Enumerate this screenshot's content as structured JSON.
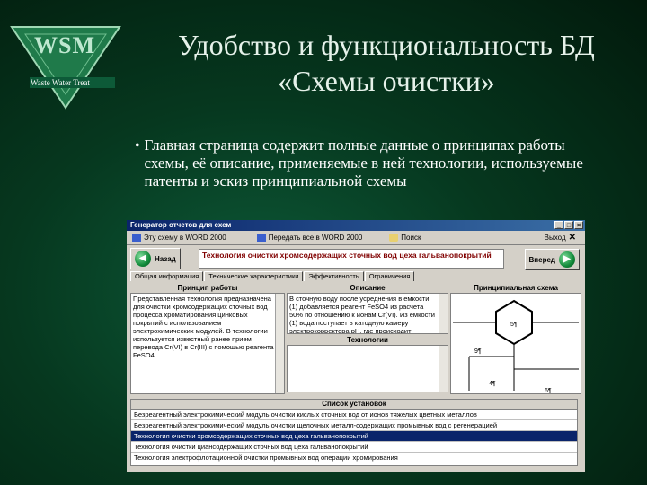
{
  "logo": {
    "text": "WSM",
    "subtitle": "Waste Water Treat"
  },
  "slide": {
    "title": "Удобство и функциональность БД «Схемы очистки»",
    "bullet": "Главная страница содержит полные данные о принципах работы схемы, её описание, применяемые в ней технологии, используемые патенты и эскиз принципиальной схемы"
  },
  "window": {
    "title": "Генератор отчетов для схем",
    "menu": {
      "word": "Эту схему в WORD 2000",
      "print_all": "Передать все в WORD 2000",
      "search": "Поиск",
      "exit": "Выход"
    },
    "nav": {
      "back": "Назад",
      "forward": "Вперед",
      "tech_name": "Технология очистки хромсодержащих сточных вод цеха гальванопокрытий"
    },
    "tabs": [
      "Общая информация",
      "Технические характеристики",
      "Эффективность",
      "Ограничения"
    ],
    "panels": {
      "principle_title": "Принцип работы",
      "principle_text": "Представленная технология предназначена для очистки хромсодержащих сточных вод процесса хроматирования цинковых покрытий с использованием электрохимических модулей. В технологии используется известный ранее прием перевода Cr(VI) в Cr(III) с помощью реагента FeSO4.",
      "desc_title": "Описание",
      "desc_text": "В сточную воду после усреднения в емкости (1) добавляется реагент FeSO4 из расчета 50% по отношению к ионам Cr(VI). Из емкости (1) вода поступает в катодную камеру электрокорректора pH, где происходит подщелачивание воды.",
      "tech_title": "Технологии",
      "scheme_title": "Принципиальная схема",
      "scheme_labels": [
        "5¶",
        "9¶",
        "4¶",
        "6¶"
      ]
    },
    "list": {
      "title": "Список установок",
      "items": [
        "Безреагентный электрохимический модуль очистки кислых сточных вод от ионов тяжелых цветных металлов",
        "Безреагентный электрохимический модуль очистки щелочных металл-содержащих промывных вод с регенерацией",
        "Технология очистки хромсодержащих сточных вод цеха гальванопокрытий",
        "Технология очистки циансодержащих сточных вод цеха гальванопокрытий",
        "Технология электрофлотационной очистки промывных вод операции хромирования"
      ],
      "selected": 2
    }
  }
}
